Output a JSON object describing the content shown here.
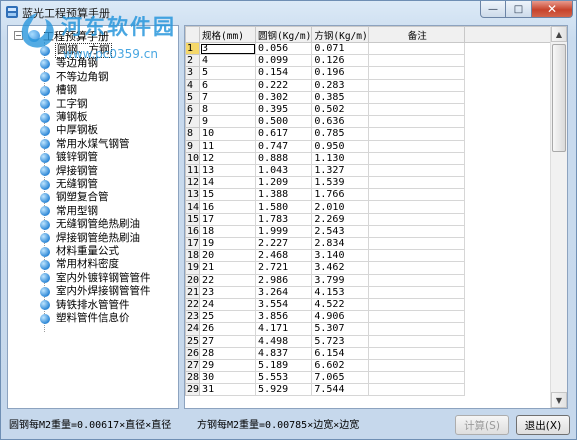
{
  "window": {
    "title": "蓝光工程预算手册",
    "minimize": "—",
    "maximize": "□",
    "close": "✕"
  },
  "watermark": {
    "title": "河东软件园",
    "url": "www.pc0359.cn"
  },
  "tree": {
    "root_label": "工程预算手册",
    "expander": "−",
    "items": [
      "圆钢、方钢",
      "等边角钢",
      "不等边角钢",
      "槽钢",
      "工字钢",
      "薄钢板",
      "中厚钢板",
      "常用水煤气钢管",
      "镀锌钢管",
      "焊接钢管",
      "无缝钢管",
      "钢塑复合管",
      "常用型钢",
      "无缝钢管绝热刷油",
      "焊接钢管绝热刷油",
      "材料重量公式",
      "常用材料密度",
      "室内外镀锌钢管管件",
      "室内外焊接钢管管件",
      "铸铁排水管管件",
      "塑料管件信息价"
    ],
    "selected_index": 0
  },
  "grid": {
    "columns": {
      "spec": "规格(mm)",
      "round": "圆钢(Kg/m)",
      "square": "方钢(Kg/m)",
      "memo": "备注"
    },
    "rows": [
      {
        "n": "1",
        "spec": "3",
        "round": "0.056",
        "square": "0.071"
      },
      {
        "n": "2",
        "spec": "4",
        "round": "0.099",
        "square": "0.126"
      },
      {
        "n": "3",
        "spec": "5",
        "round": "0.154",
        "square": "0.196"
      },
      {
        "n": "4",
        "spec": "6",
        "round": "0.222",
        "square": "0.283"
      },
      {
        "n": "5",
        "spec": "7",
        "round": "0.302",
        "square": "0.385"
      },
      {
        "n": "6",
        "spec": "8",
        "round": "0.395",
        "square": "0.502"
      },
      {
        "n": "7",
        "spec": "9",
        "round": "0.500",
        "square": "0.636"
      },
      {
        "n": "8",
        "spec": "10",
        "round": "0.617",
        "square": "0.785"
      },
      {
        "n": "9",
        "spec": "11",
        "round": "0.747",
        "square": "0.950"
      },
      {
        "n": "10",
        "spec": "12",
        "round": "0.888",
        "square": "1.130"
      },
      {
        "n": "11",
        "spec": "13",
        "round": "1.043",
        "square": "1.327"
      },
      {
        "n": "12",
        "spec": "14",
        "round": "1.209",
        "square": "1.539"
      },
      {
        "n": "13",
        "spec": "15",
        "round": "1.388",
        "square": "1.766"
      },
      {
        "n": "14",
        "spec": "16",
        "round": "1.580",
        "square": "2.010"
      },
      {
        "n": "15",
        "spec": "17",
        "round": "1.783",
        "square": "2.269"
      },
      {
        "n": "16",
        "spec": "18",
        "round": "1.999",
        "square": "2.543"
      },
      {
        "n": "17",
        "spec": "19",
        "round": "2.227",
        "square": "2.834"
      },
      {
        "n": "18",
        "spec": "20",
        "round": "2.468",
        "square": "3.140"
      },
      {
        "n": "19",
        "spec": "21",
        "round": "2.721",
        "square": "3.462"
      },
      {
        "n": "20",
        "spec": "22",
        "round": "2.986",
        "square": "3.799"
      },
      {
        "n": "21",
        "spec": "23",
        "round": "3.264",
        "square": "4.153"
      },
      {
        "n": "22",
        "spec": "24",
        "round": "3.554",
        "square": "4.522"
      },
      {
        "n": "23",
        "spec": "25",
        "round": "3.856",
        "square": "4.906"
      },
      {
        "n": "24",
        "spec": "26",
        "round": "4.171",
        "square": "5.307"
      },
      {
        "n": "25",
        "spec": "27",
        "round": "4.498",
        "square": "5.723"
      },
      {
        "n": "26",
        "spec": "28",
        "round": "4.837",
        "square": "6.154"
      },
      {
        "n": "27",
        "spec": "29",
        "round": "5.189",
        "square": "6.602"
      },
      {
        "n": "28",
        "spec": "30",
        "round": "5.553",
        "square": "7.065"
      },
      {
        "n": "29",
        "spec": "31",
        "round": "5.929",
        "square": "7.544"
      }
    ],
    "active_row": 0
  },
  "footer": {
    "round_formula": "圆钢每M2重量=0.00617×直径×直径",
    "square_formula": "方钢每M2重量=0.00785×边宽×边宽",
    "calc_button": "计算(S)",
    "exit_button": "退出(X)"
  },
  "colors": {
    "frame": "#c9dbee",
    "header": "#f0f0f0",
    "active_rownum": "#f5d86a",
    "tree_icon": "#2a85d5",
    "close_button": "#c7432c"
  }
}
